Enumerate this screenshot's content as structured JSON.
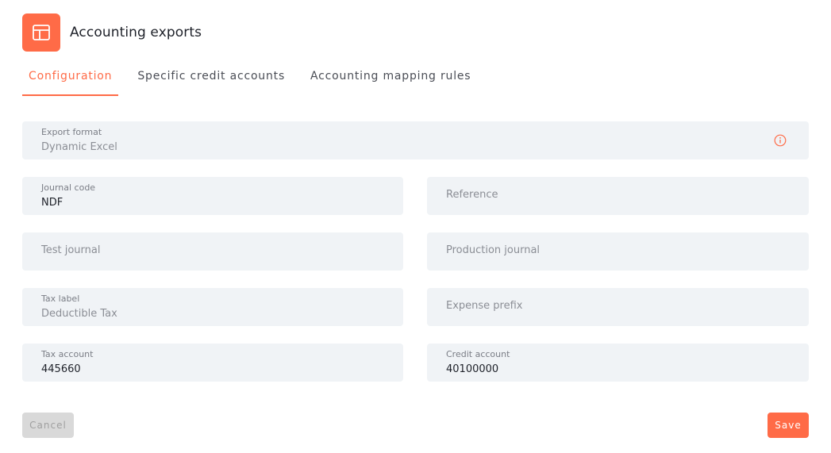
{
  "app": {
    "title": "Accounting exports",
    "icon": "layout-table-icon",
    "accent": "#ff6b47"
  },
  "tabs": [
    {
      "label": "Configuration",
      "active": true
    },
    {
      "label": "Specific credit accounts",
      "active": false
    },
    {
      "label": "Accounting mapping rules",
      "active": false
    }
  ],
  "form": {
    "export_format": {
      "label": "Export format",
      "value": "Dynamic Excel"
    },
    "journal_code": {
      "label": "Journal code",
      "value": "NDF"
    },
    "reference": {
      "placeholder": "Reference"
    },
    "test_journal": {
      "placeholder": "Test journal"
    },
    "production_journal": {
      "placeholder": "Production journal"
    },
    "tax_label": {
      "label": "Tax label",
      "value": "Deductible Tax"
    },
    "expense_prefix": {
      "placeholder": "Expense prefix"
    },
    "tax_account": {
      "label": "Tax account",
      "value": "445660"
    },
    "credit_account": {
      "label": "Credit account",
      "value": "40100000"
    }
  },
  "actions": {
    "cancel": "Cancel",
    "save": "Save"
  }
}
